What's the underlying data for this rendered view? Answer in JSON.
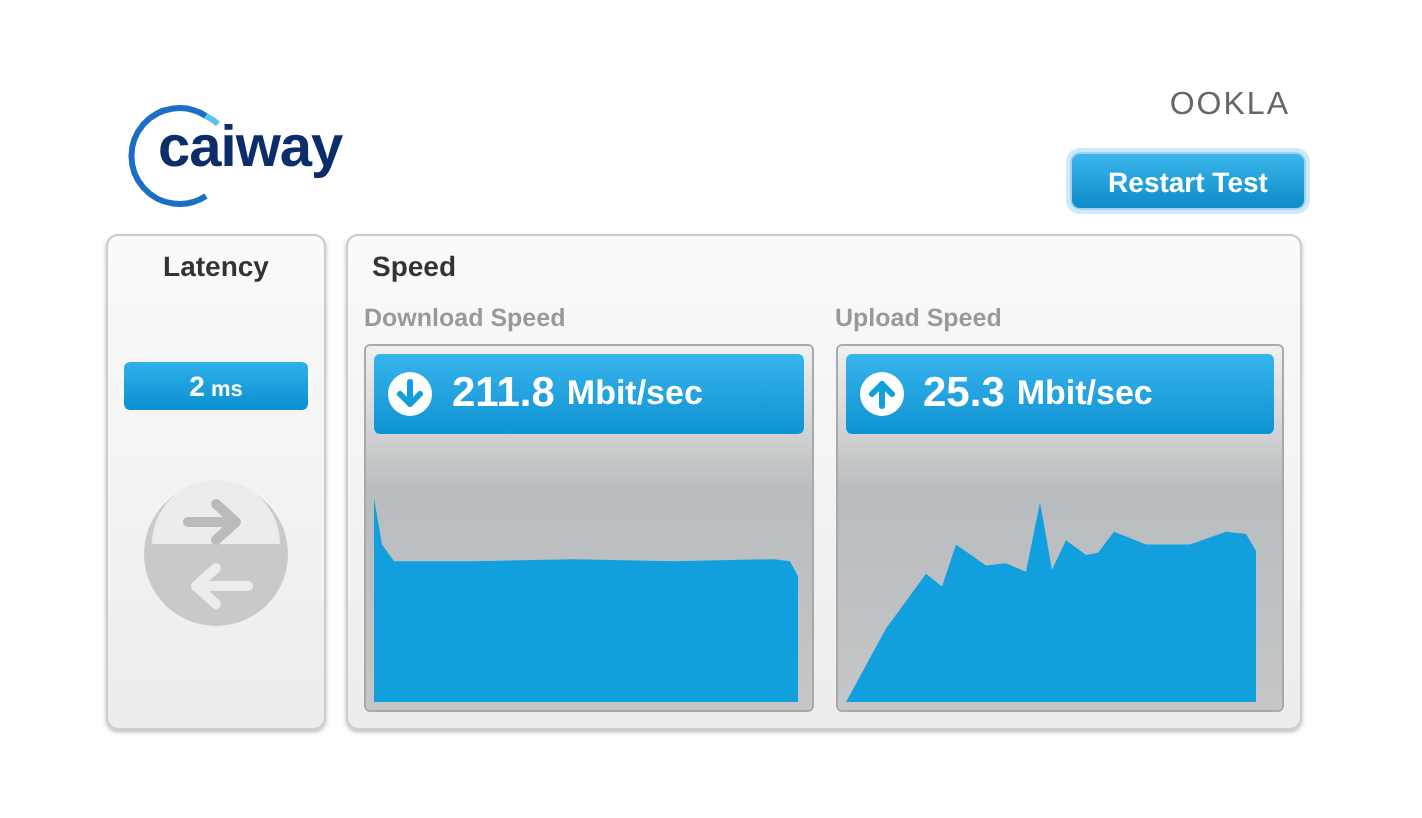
{
  "header": {
    "logo": "caiway",
    "brand": "OOKLA",
    "restart_button": "Restart Test"
  },
  "latency": {
    "title": "Latency",
    "value": "2",
    "unit": "ms"
  },
  "speed": {
    "title": "Speed",
    "meters": [
      {
        "kind": "download",
        "label": "Download Speed",
        "value": "211.8",
        "unit": "Mbit/sec"
      },
      {
        "kind": "upload",
        "label": "Upload Speed",
        "value": "25.3",
        "unit": "Mbit/sec"
      }
    ]
  }
}
